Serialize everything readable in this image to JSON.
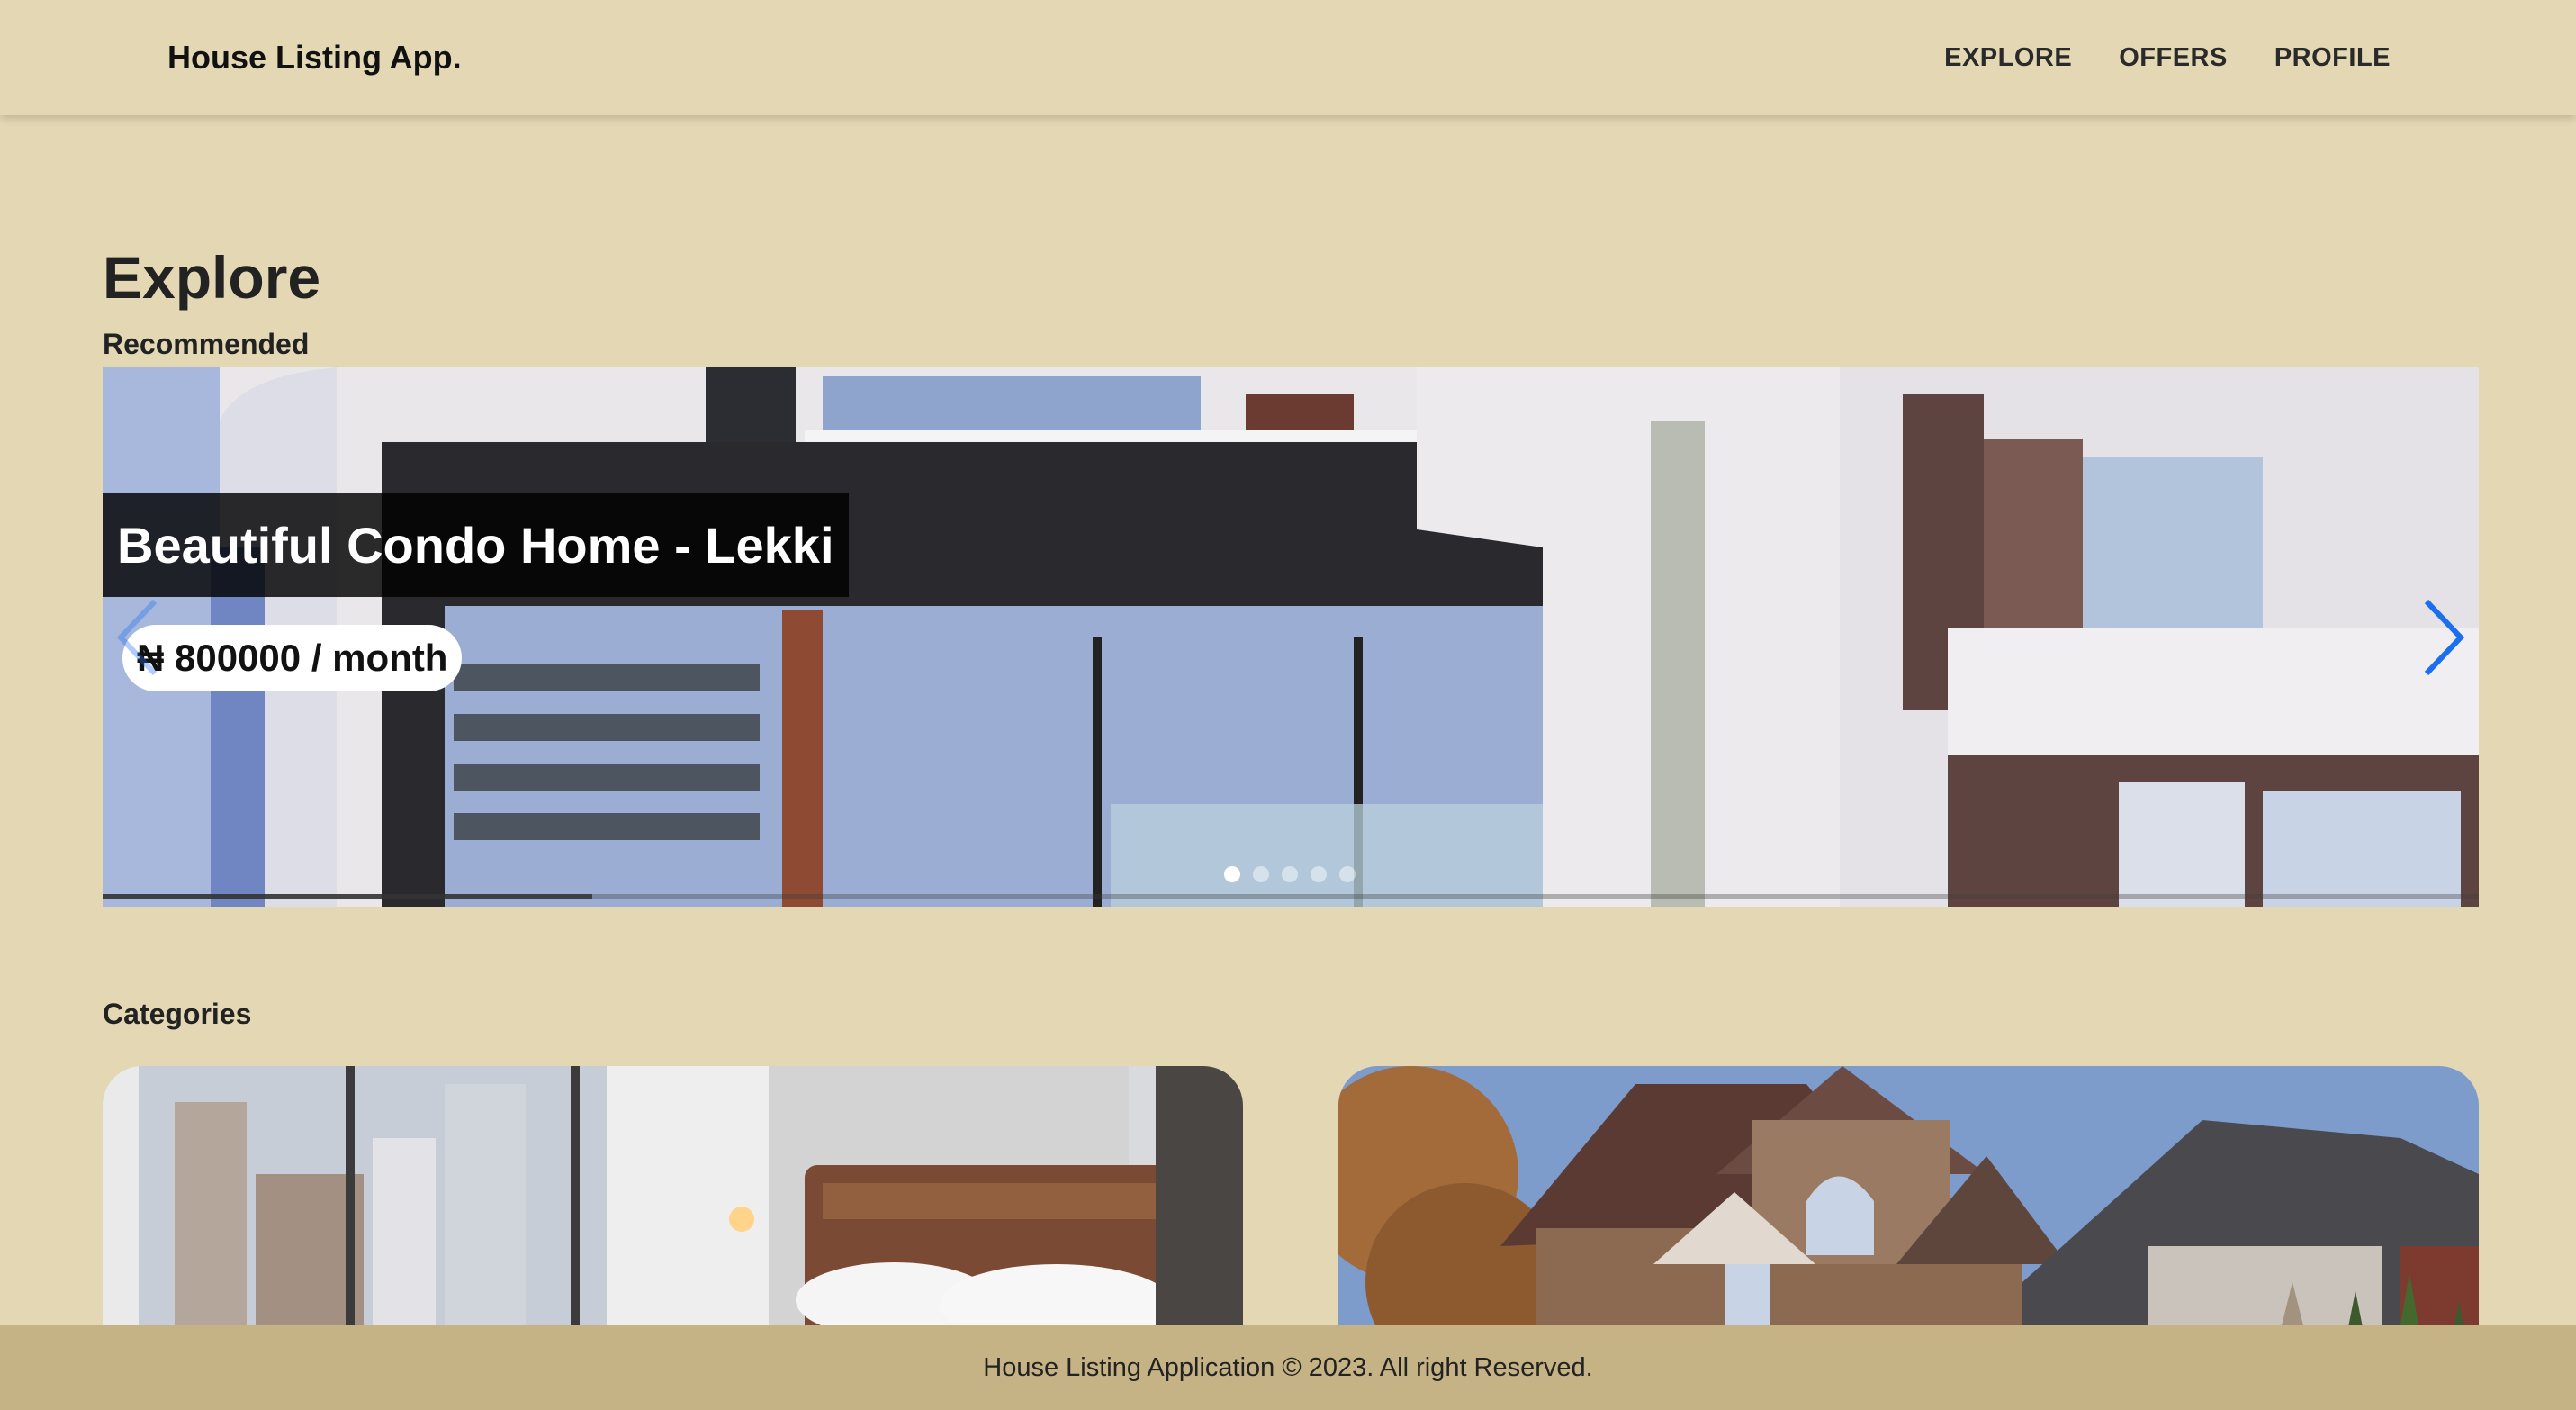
{
  "header": {
    "brand": "House Listing App.",
    "nav": [
      "EXPLORE",
      "OFFERS",
      "PROFILE"
    ]
  },
  "main": {
    "title": "Explore",
    "recommended_label": "Recommended",
    "categories_label": "Categories"
  },
  "slider": {
    "slide_title": "Beautiful Condo Home - Lekki",
    "slide_price": "₦ 800000 / month",
    "dots_count": 5,
    "active_dot": 0,
    "progress": 0.206,
    "arrow_color": "#1a6ef0"
  },
  "categories": [
    {
      "image": "bedroom-interior"
    },
    {
      "image": "suburban-house-exterior"
    }
  ],
  "footer": {
    "text": "House Listing Application © 2023. All right Reserved."
  },
  "colors": {
    "background": "#e4d8b4",
    "footer": "#c6b385"
  }
}
